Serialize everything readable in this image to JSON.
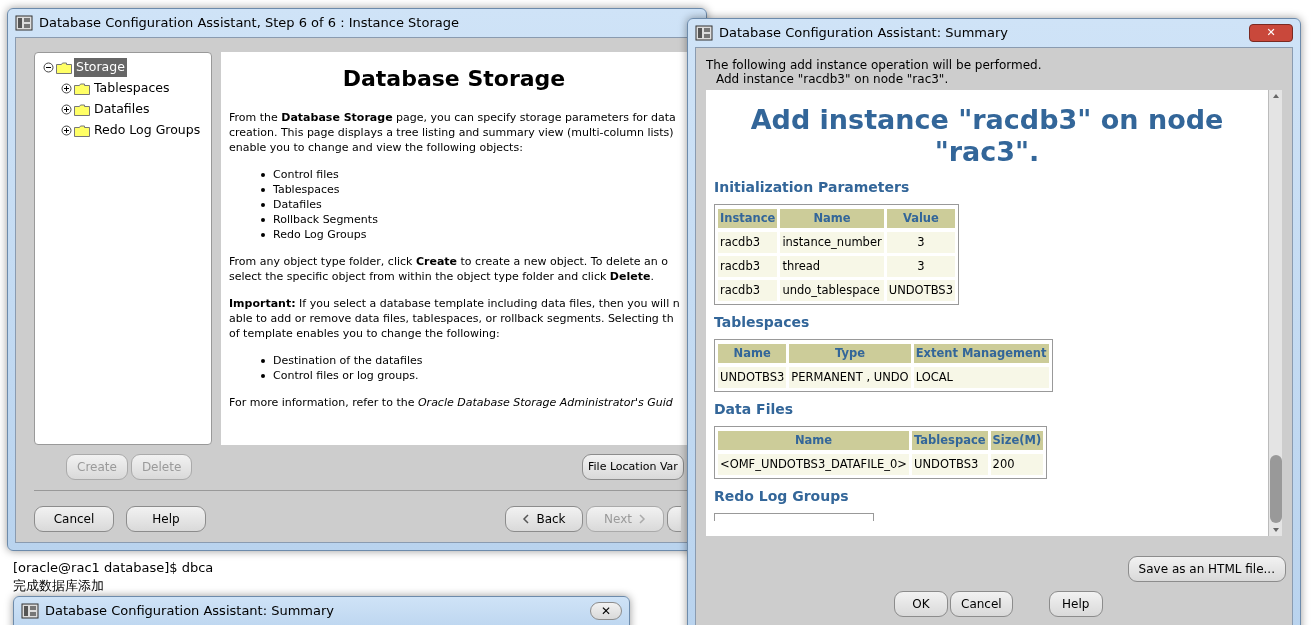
{
  "background_page": {
    "lines": [
      "[oracle@rac1 database]$ dbca",
      "完成数据库添加"
    ],
    "bottom_window": {
      "title": "Database Configuration Assistant: Summary",
      "close": "✕"
    }
  },
  "storage_window": {
    "title": "Database Configuration Assistant, Step 6 of 6 : Instance Storage",
    "tree": [
      {
        "label": "Storage",
        "selected": true,
        "expanded": true,
        "children": [
          {
            "label": "Tablespaces",
            "selected": false,
            "expanded": false
          },
          {
            "label": "Datafiles",
            "selected": false,
            "expanded": false
          },
          {
            "label": "Redo Log Groups",
            "selected": false,
            "expanded": false
          }
        ]
      }
    ],
    "heading": "Database Storage",
    "blocks": [
      {
        "kind": "para",
        "lines": [
          "From the **Database Storage** page, you can specify storage parameters for data",
          "creation. This page displays a tree listing and summary view (multi-column lists)",
          "enable you to change and view the following objects:"
        ]
      },
      {
        "kind": "list",
        "items": [
          "Control files",
          "Tablespaces",
          "Datafiles",
          "Rollback Segments",
          "Redo Log Groups"
        ]
      },
      {
        "kind": "para",
        "lines": [
          "From any object type folder, click **Create** to create a new object. To delete an o",
          "select the specific object from within the object type folder and click **Delete**."
        ]
      },
      {
        "kind": "para",
        "lines": [
          "**Important:** If you select a database template including data files, then you will n",
          "able to add or remove data files, tablespaces, or rollback segments. Selecting th",
          "of template enables you to change the following:"
        ]
      },
      {
        "kind": "list",
        "items": [
          "Destination of the datafiles",
          "Control files or log groups."
        ]
      },
      {
        "kind": "para",
        "lines": [
          "For more information, refer to the *Oracle Database Storage Administrator's Guid*"
        ]
      }
    ],
    "tree_buttons": [
      {
        "label": "Create",
        "disabled": true
      },
      {
        "label": "Delete",
        "disabled": true
      }
    ],
    "file_location_button": "File Location Var",
    "footer_left": [
      {
        "label": "Cancel",
        "disabled": false
      },
      {
        "label": "Help",
        "disabled": false
      }
    ],
    "footer_right": [
      {
        "label": "Back",
        "disabled": false,
        "kind": "back"
      },
      {
        "label": "Next",
        "disabled": true,
        "kind": "next"
      }
    ]
  },
  "summary_dialog": {
    "title": "Database Configuration Assistant: Summary",
    "close": "✕",
    "intro": [
      "The following add instance operation will be performed.",
      "Add instance \"racdb3\" on node \"rac3\"."
    ],
    "heading": "Add instance \"racdb3\" on node \"rac3\".",
    "sections": [
      {
        "title": "Initialization Parameters",
        "columns": [
          "Instance",
          "Name",
          "Value"
        ],
        "rows": [
          [
            "racdb3",
            "instance_number",
            "3"
          ],
          [
            "racdb3",
            "thread",
            "3"
          ],
          [
            "racdb3",
            "undo_tablespace",
            "UNDOTBS3"
          ]
        ]
      },
      {
        "title": "Tablespaces",
        "columns": [
          "Name",
          "Type",
          "Extent Management"
        ],
        "rows": [
          [
            "UNDOTBS3",
            "PERMANENT , UNDO",
            "LOCAL"
          ]
        ]
      },
      {
        "title": "Data Files",
        "columns": [
          "Name",
          "Tablespace",
          "Size(M)"
        ],
        "rows": [
          [
            "<OMF_UNDOTBS3_DATAFILE_0>",
            "UNDOTBS3",
            "200"
          ]
        ]
      },
      {
        "title": "Redo Log Groups"
      }
    ],
    "save_button": "Save as an HTML file...",
    "buttons": [
      "OK",
      "Cancel",
      "Help"
    ]
  }
}
